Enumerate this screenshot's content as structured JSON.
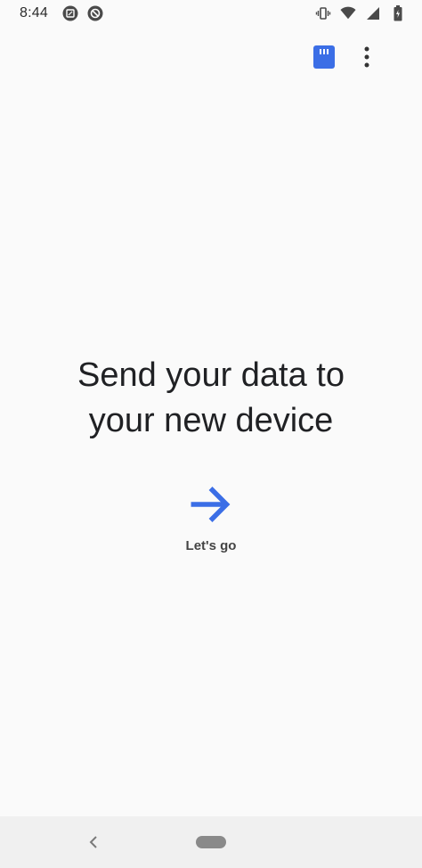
{
  "status_bar": {
    "time": "8:44",
    "icons_left": [
      "screenshot-icon",
      "block-icon"
    ],
    "icons_right": [
      "vibrate-icon",
      "wifi-icon",
      "signal-icon",
      "battery-icon"
    ]
  },
  "app_bar": {
    "icons": [
      "sd-card-icon",
      "more-vert-icon"
    ],
    "accent_color": "#3b6ee6"
  },
  "hero": {
    "title_line1": "Send your data to",
    "title_line2": "your new device"
  },
  "action": {
    "label": "Let's go",
    "icon": "arrow-forward-icon",
    "color": "#3b6ee6"
  },
  "nav_bar": {
    "icons": [
      "back-icon",
      "home-pill"
    ]
  }
}
